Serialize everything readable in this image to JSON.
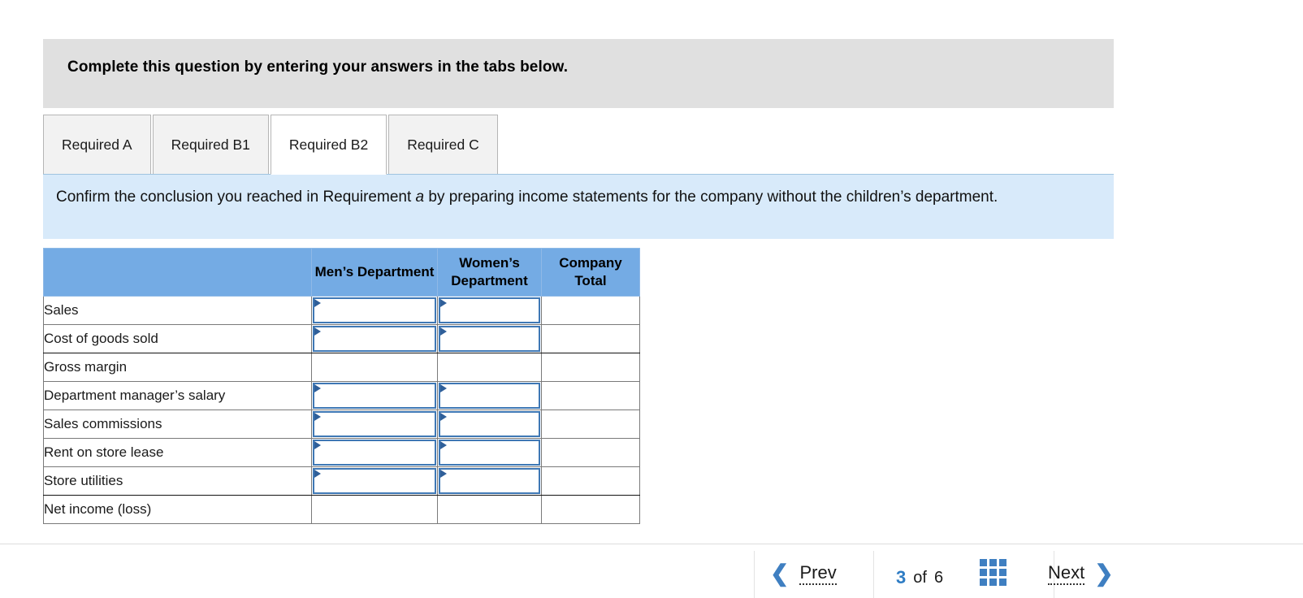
{
  "banner": {
    "text": "Complete this question by entering your answers in the tabs below."
  },
  "tabs": {
    "items": [
      {
        "label": "Required A",
        "active": false
      },
      {
        "label": "Required B1",
        "active": false
      },
      {
        "label": "Required B2",
        "active": true
      },
      {
        "label": "Required C",
        "active": false
      }
    ]
  },
  "question": {
    "text_before": "Confirm the conclusion you reached in Requirement ",
    "emphasis": "a",
    "text_after": " by preparing income statements for the company without the children’s department."
  },
  "worksheet": {
    "columns": [
      "",
      "Men’s Department",
      "Women’s Department",
      "Company Total"
    ],
    "rows": [
      {
        "label": "Sales",
        "men": "input",
        "women": "input",
        "total": "plain",
        "rule_below": false
      },
      {
        "label": "Cost of goods sold",
        "men": "input",
        "women": "input",
        "total": "plain",
        "rule_below": true
      },
      {
        "label": "Gross margin",
        "men": "plain",
        "women": "plain",
        "total": "plain",
        "rule_below": false
      },
      {
        "label": "Department manager’s salary",
        "men": "input",
        "women": "input",
        "total": "plain",
        "rule_below": false
      },
      {
        "label": "Sales commissions",
        "men": "input",
        "women": "input",
        "total": "plain",
        "rule_below": false
      },
      {
        "label": "Rent on store lease",
        "men": "input",
        "women": "input",
        "total": "plain",
        "rule_below": false
      },
      {
        "label": "Store utilities",
        "men": "input",
        "women": "input",
        "total": "plain",
        "rule_below": true
      },
      {
        "label": "Net income (loss)",
        "men": "plain",
        "women": "plain",
        "total": "plain",
        "rule_below": false
      }
    ]
  },
  "navigation": {
    "prev_label": "Prev",
    "next_label": "Next",
    "prev_icon": "chevron-left-icon",
    "next_icon": "chevron-right-icon",
    "current_page": "3",
    "of_label": "of",
    "total_pages": "6",
    "grid_icon": "grid-menu-icon"
  },
  "colors": {
    "header_blue": "#74abe4",
    "panel_blue": "#d8eafa",
    "banner_gray": "#e0e0e0",
    "accent_blue": "#3f7fc1",
    "input_border": "#3f78b5"
  }
}
